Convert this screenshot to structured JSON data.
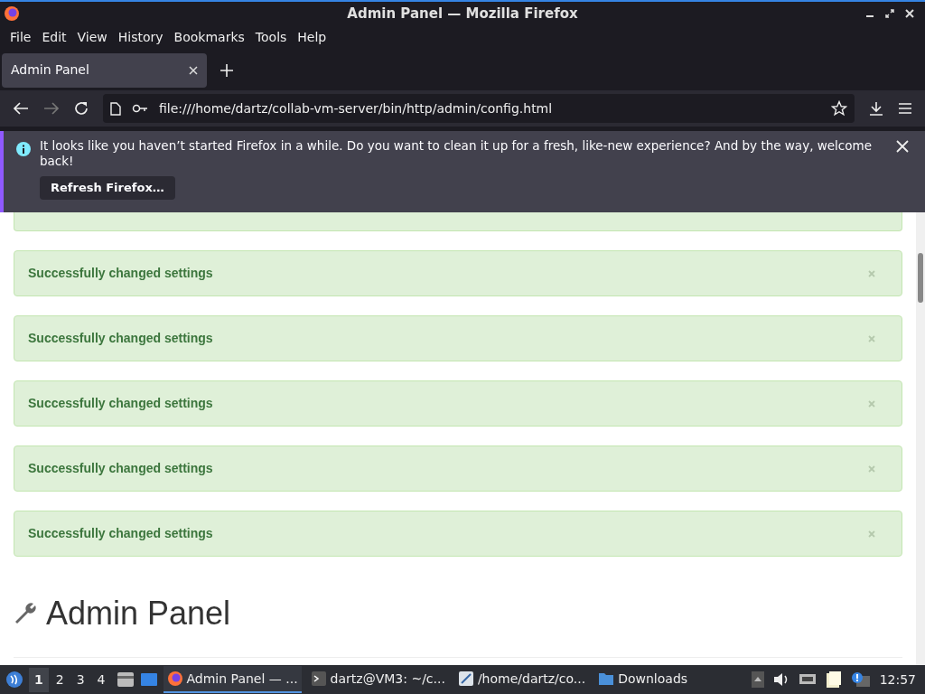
{
  "window": {
    "title": "Admin Panel — Mozilla Firefox"
  },
  "menu": [
    "File",
    "Edit",
    "View",
    "History",
    "Bookmarks",
    "Tools",
    "Help"
  ],
  "tabs": [
    {
      "label": "Admin Panel",
      "selected": true
    }
  ],
  "address_bar": {
    "url": "file:///home/dartz/collab-vm-server/bin/http/admin/config.html"
  },
  "notification": {
    "message": "It looks like you haven’t started Firefox in a while. Do you want to clean it up for a fresh, like-new experience? And by the way, welcome back!",
    "button": "Refresh Firefox…"
  },
  "alerts": [
    {
      "kind": "clipped"
    },
    {
      "kind": "full",
      "text": "Successfully changed settings"
    },
    {
      "kind": "full",
      "text": "Successfully changed settings"
    },
    {
      "kind": "full",
      "text": "Successfully changed settings"
    },
    {
      "kind": "full",
      "text": "Successfully changed settings"
    },
    {
      "kind": "full",
      "text": "Successfully changed settings"
    }
  ],
  "page_heading": "Admin Panel",
  "taskbar": {
    "workspaces": [
      {
        "label": "1",
        "selected": true
      },
      {
        "label": "2",
        "selected": false
      },
      {
        "label": "3",
        "selected": false
      },
      {
        "label": "4",
        "selected": false
      }
    ],
    "tasks": [
      {
        "kind": "firefox",
        "label": "Admin Panel — ...",
        "selected": true
      },
      {
        "kind": "terminal",
        "label": "dartz@VM3: ~/c...",
        "selected": false
      },
      {
        "kind": "editor",
        "label": "/home/dartz/co...",
        "selected": false
      },
      {
        "kind": "folder",
        "label": "Downloads",
        "selected": false
      }
    ],
    "clock": "12:57"
  }
}
